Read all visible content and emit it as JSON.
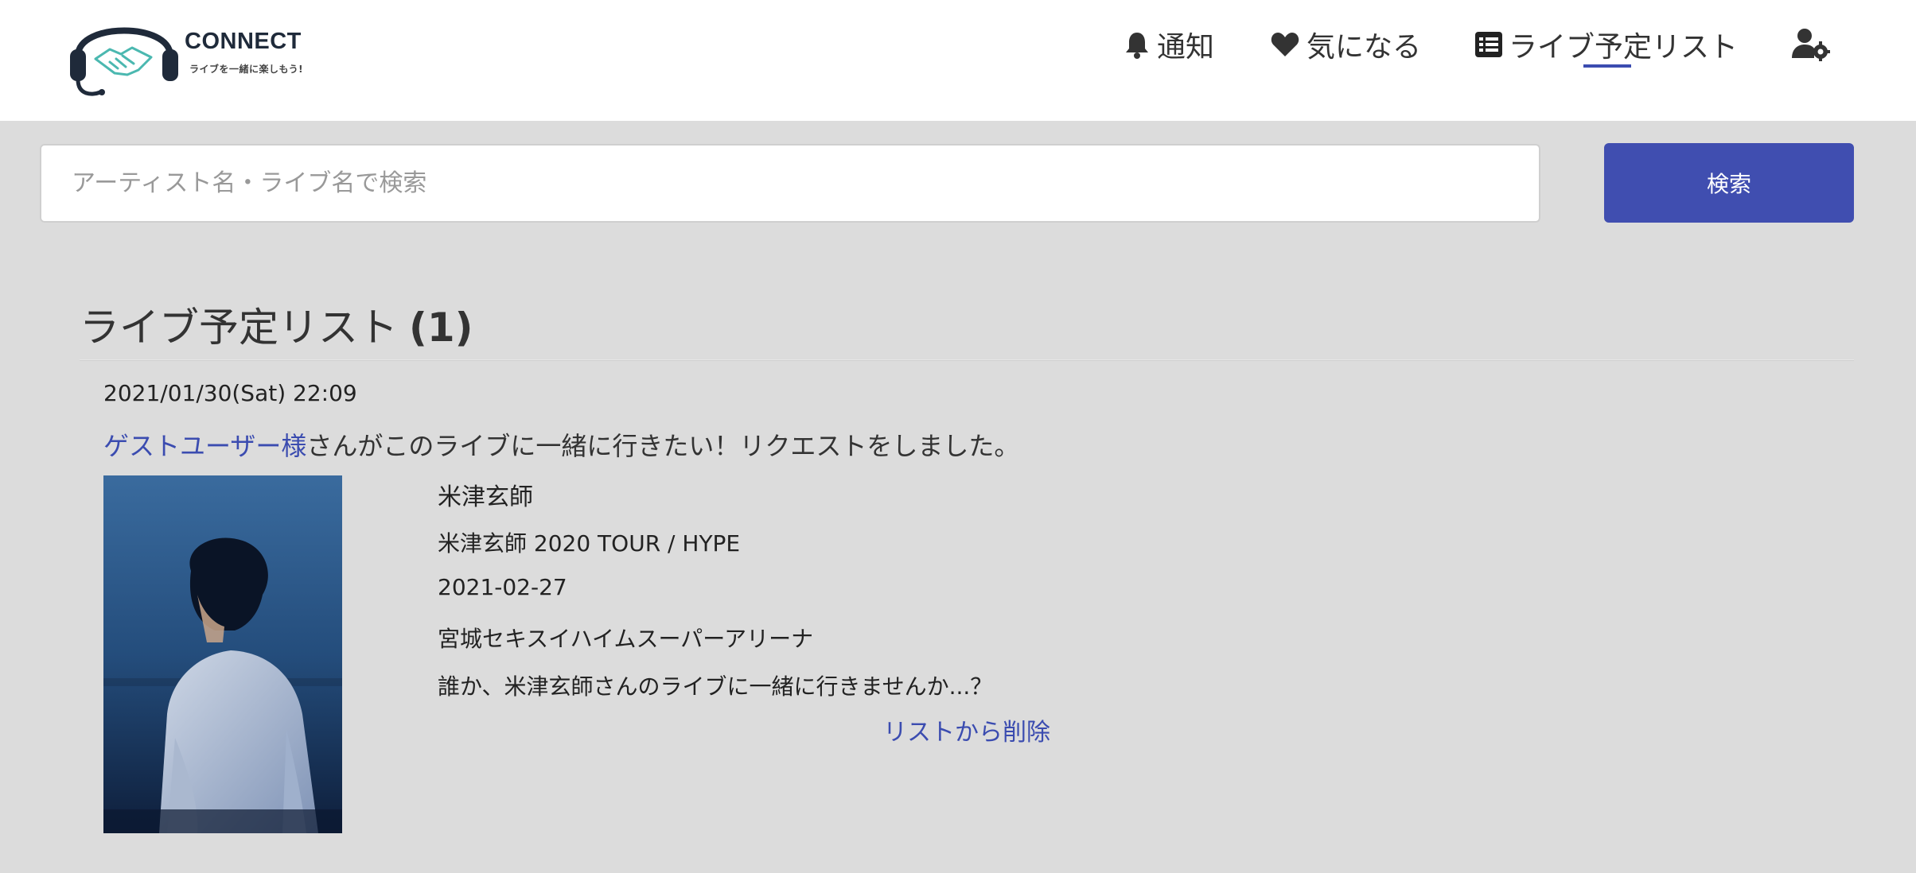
{
  "header": {
    "logo": {
      "title": "CONNECT",
      "tagline": "ライブを一緒に楽しもう!"
    },
    "nav": [
      {
        "label": "通知",
        "icon": "bell-icon"
      },
      {
        "label": "気になる",
        "icon": "heart-icon"
      },
      {
        "label": "ライブ予定リスト",
        "icon": "list-icon",
        "active": true
      },
      {
        "label": "",
        "icon": "user-settings-icon"
      }
    ]
  },
  "search": {
    "placeholder": "アーティスト名・ライブ名で検索",
    "value": "",
    "button_label": "検索"
  },
  "main": {
    "title": "ライブ予定リスト",
    "count": "(1)",
    "entries": [
      {
        "timestamp": "2021/01/30(Sat) 22:09",
        "requester": "ゲストユーザー様",
        "request_text": "さんがこのライブに一緒に行きたい！リクエストをしました。",
        "artist": "米津玄師",
        "live_title": "米津玄師 2020 TOUR / HYPE",
        "date": "2021-02-27",
        "venue": "宮城セキスイハイムスーパーアリーナ",
        "message": "誰か、米津玄師さんのライブに一緒に行きませんか...？",
        "remove_label": "リストから削除"
      }
    ]
  },
  "colors": {
    "accent": "#404eb0",
    "link": "#3b4cb0",
    "background": "#dcdcdc",
    "header_bg": "#ffffff"
  }
}
